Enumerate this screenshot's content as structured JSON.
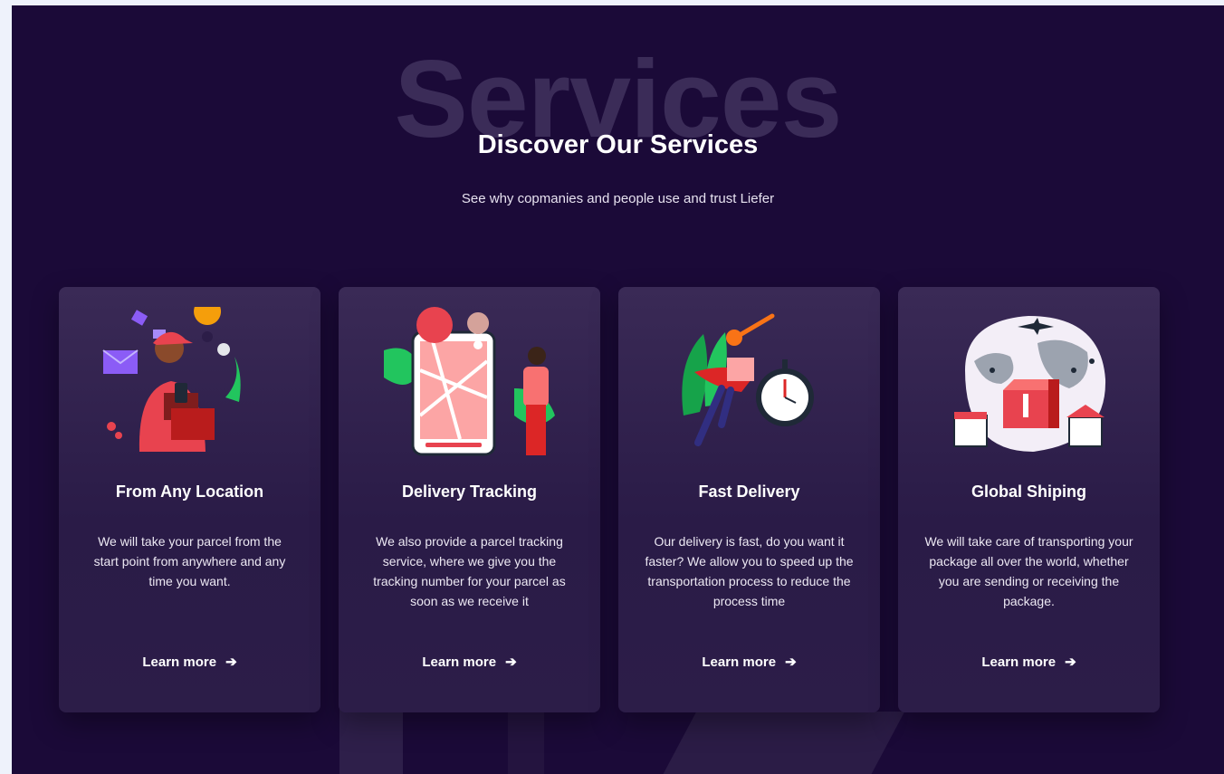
{
  "section": {
    "background_word": "Services",
    "title": "Discover Our Services",
    "subtitle": "See why copmanies and people use and trust Liefer"
  },
  "cards": [
    {
      "title": "From Any Location",
      "description": "We will take your parcel from the start point from anywhere and any time you want.",
      "link": "Learn more",
      "illustration": "courier-with-parcel-icon"
    },
    {
      "title": "Delivery Tracking",
      "description": "We also provide a parcel tracking service, where we give you the tracking number for your parcel as soon as we receive it",
      "link": "Learn more",
      "illustration": "phone-map-tracking-icon"
    },
    {
      "title": "Fast Delivery",
      "description": "Our delivery is fast, do you want it faster? We allow you to speed up the transportation process to reduce the process time",
      "link": "Learn more",
      "illustration": "flying-courier-stopwatch-icon"
    },
    {
      "title": "Global Shiping",
      "description": "We will take care of transporting your package all over the world, whether you are sending or receiving the package.",
      "link": "Learn more",
      "illustration": "world-map-parcel-icon"
    }
  ],
  "colors": {
    "background": "#1b0a38",
    "card": "#33234f",
    "accent_red": "#e8434f",
    "text": "#ffffff"
  }
}
